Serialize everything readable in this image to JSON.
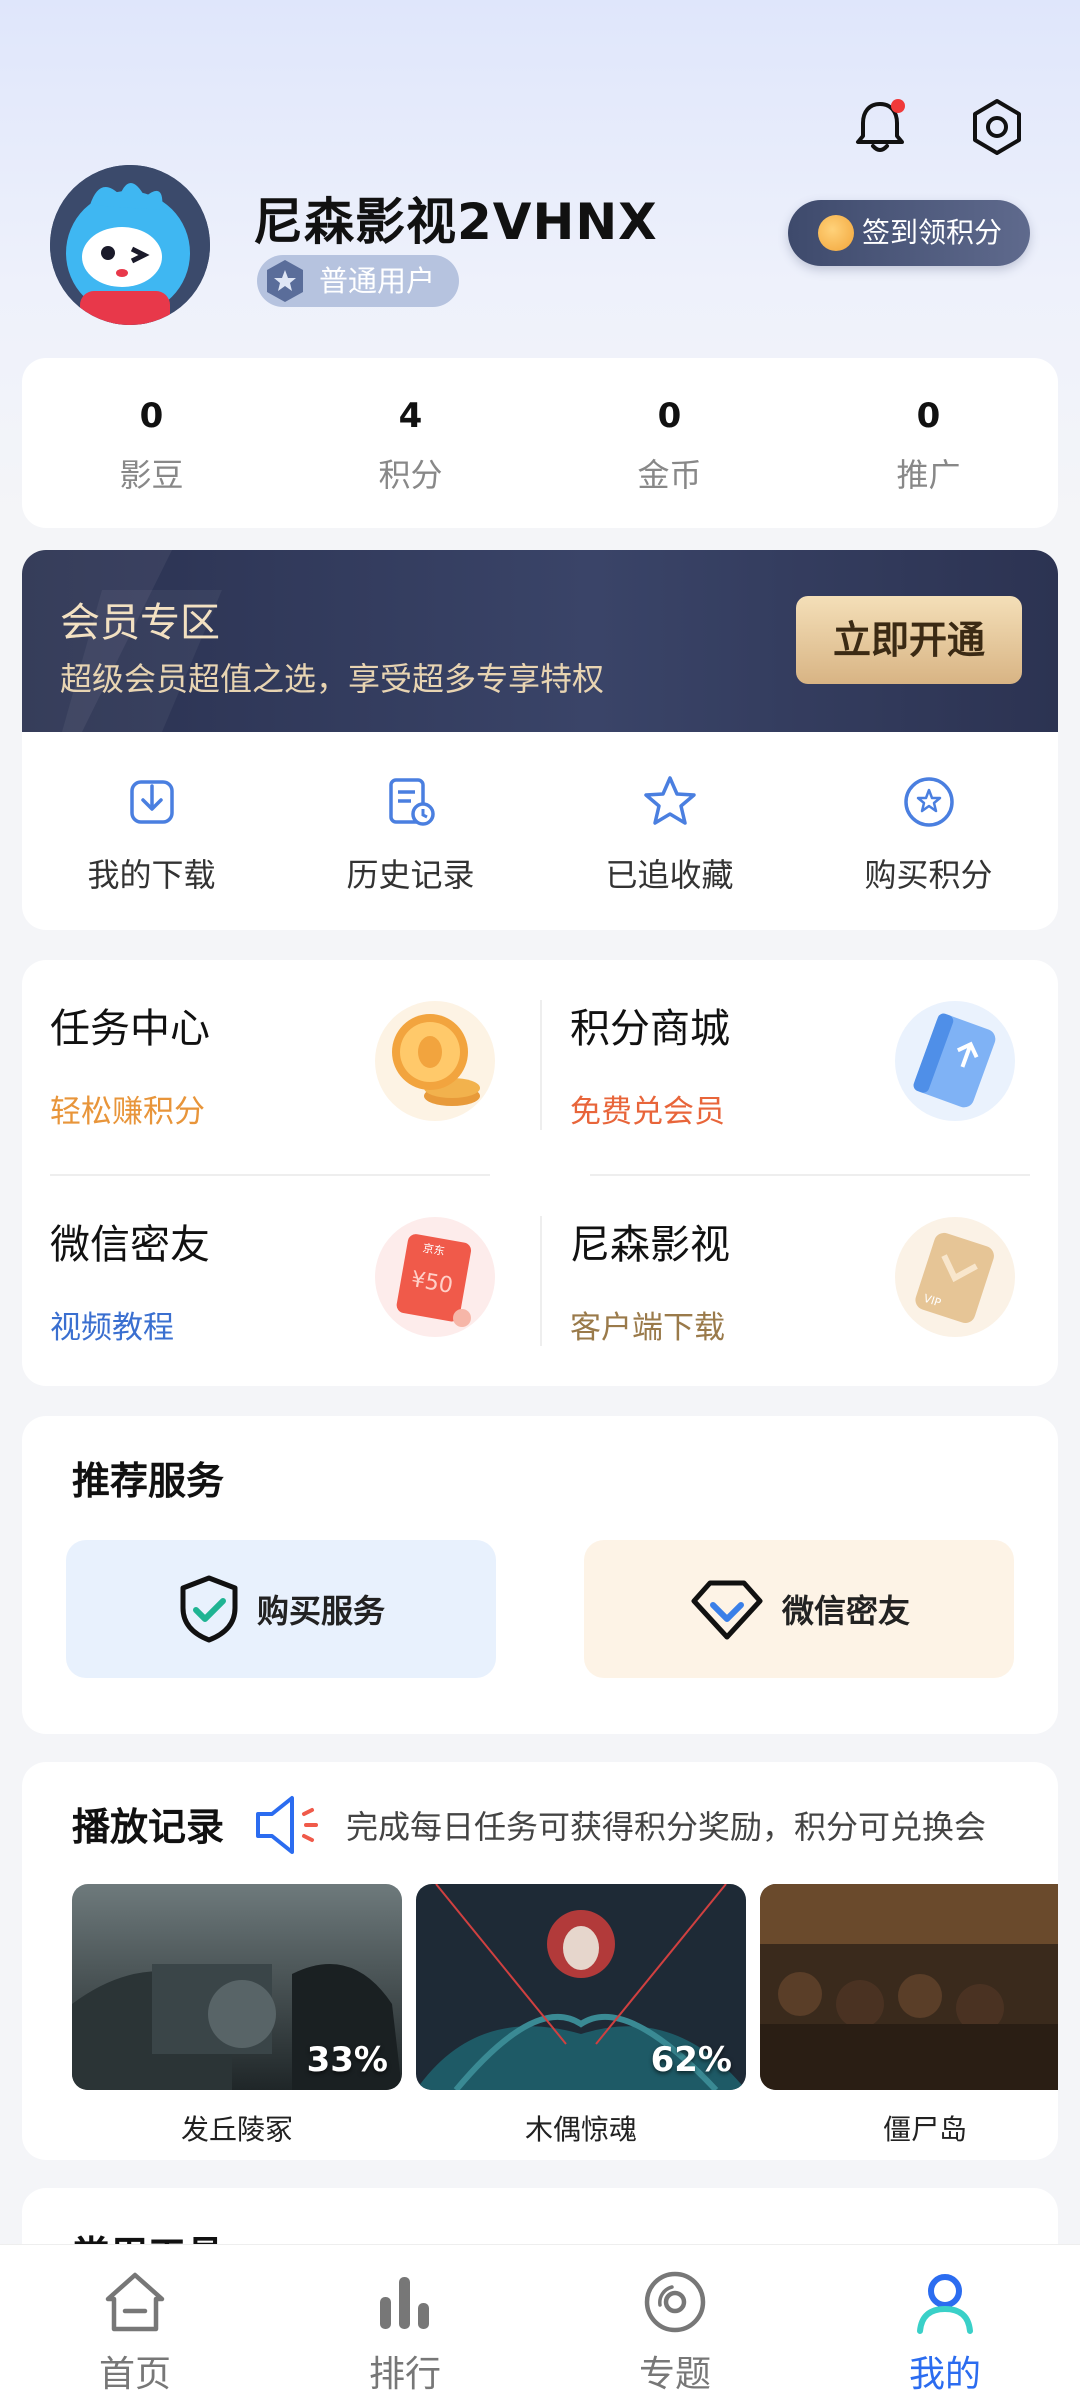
{
  "profile": {
    "username": "尼森影视2VHNX",
    "user_level": "普通用户",
    "signin_label": "签到领积分"
  },
  "stats": [
    {
      "value": "0",
      "label": "影豆"
    },
    {
      "value": "4",
      "label": "积分"
    },
    {
      "value": "0",
      "label": "金币"
    },
    {
      "value": "0",
      "label": "推广"
    }
  ],
  "vip": {
    "title": "会员专区",
    "subtitle": "超级会员超值之选，享受超多专享特权",
    "cta": "立即开通"
  },
  "quick_actions": [
    {
      "label": "我的下载",
      "icon": "download-icon"
    },
    {
      "label": "历史记录",
      "icon": "history-icon"
    },
    {
      "label": "已追收藏",
      "icon": "star-icon"
    },
    {
      "label": "购买积分",
      "icon": "points-icon"
    }
  ],
  "tasks": [
    {
      "title": "任务中心",
      "subtitle": "轻松赚积分",
      "subtitle_color": "#e8953a",
      "icon": "coin-stack-icon"
    },
    {
      "title": "积分商城",
      "subtitle": "免费兑会员",
      "subtitle_color": "#e8653a",
      "icon": "card-icon"
    },
    {
      "title": "微信密友",
      "subtitle": "视频教程",
      "subtitle_color": "#3a6fd0",
      "icon": "red-envelope-icon",
      "envelope_text": "¥50",
      "envelope_brand": "京东"
    },
    {
      "title": "尼森影视",
      "subtitle": "客户端下载",
      "subtitle_color": "#9a7a4a",
      "icon": "vip-card-icon",
      "card_text": "VIP"
    }
  ],
  "services": {
    "title": "推荐服务",
    "items": [
      {
        "label": "购买服务",
        "icon": "shield-check-icon",
        "bg": "#e8f1fd"
      },
      {
        "label": "微信密友",
        "icon": "diamond-icon",
        "bg": "#fdf3e6"
      }
    ]
  },
  "history": {
    "title": "播放记录",
    "notice": "完成每日任务可获得积分奖励，积分可兑换会",
    "items": [
      {
        "title": "发丘陵冢",
        "progress": "33%"
      },
      {
        "title": "木偶惊魂",
        "progress": "62%"
      },
      {
        "title": "僵尸岛",
        "progress": ""
      }
    ]
  },
  "tools": {
    "title": "常用工具"
  },
  "nav": [
    {
      "label": "首页",
      "icon": "home-icon",
      "active": false
    },
    {
      "label": "排行",
      "icon": "ranking-icon",
      "active": false
    },
    {
      "label": "专题",
      "icon": "disc-icon",
      "active": false
    },
    {
      "label": "我的",
      "icon": "profile-icon",
      "active": true
    }
  ],
  "colors": {
    "accent": "#2b6cf0",
    "vip_gold": "#d8b484",
    "vip_dark": "#2a3150"
  }
}
